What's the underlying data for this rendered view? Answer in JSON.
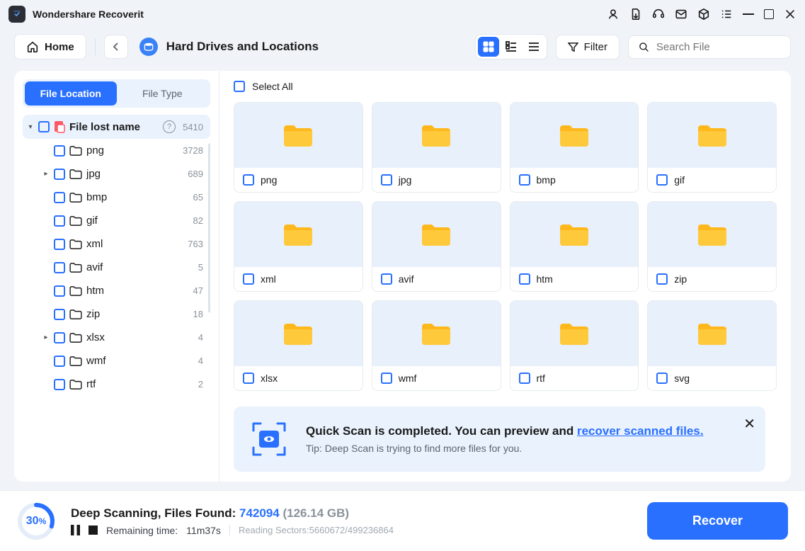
{
  "app": {
    "title": "Wondershare Recoverit"
  },
  "toolbar": {
    "home": "Home",
    "location_title": "Hard Drives and Locations",
    "filter": "Filter",
    "search_placeholder": "Search File"
  },
  "sidebar": {
    "tabs": {
      "location": "File Location",
      "type": "File Type"
    },
    "root": {
      "label": "File lost name",
      "count": "5410"
    },
    "items": [
      {
        "label": "png",
        "count": "3728",
        "expandable": false
      },
      {
        "label": "jpg",
        "count": "689",
        "expandable": true
      },
      {
        "label": "bmp",
        "count": "65",
        "expandable": false
      },
      {
        "label": "gif",
        "count": "82",
        "expandable": false
      },
      {
        "label": "xml",
        "count": "763",
        "expandable": false
      },
      {
        "label": "avif",
        "count": "5",
        "expandable": false
      },
      {
        "label": "htm",
        "count": "47",
        "expandable": false
      },
      {
        "label": "zip",
        "count": "18",
        "expandable": false
      },
      {
        "label": "xlsx",
        "count": "4",
        "expandable": true
      },
      {
        "label": "wmf",
        "count": "4",
        "expandable": false
      },
      {
        "label": "rtf",
        "count": "2",
        "expandable": false
      }
    ]
  },
  "content": {
    "select_all": "Select All",
    "folders": [
      "png",
      "jpg",
      "bmp",
      "gif",
      "xml",
      "avif",
      "htm",
      "zip",
      "xlsx",
      "wmf",
      "rtf",
      "svg"
    ]
  },
  "banner": {
    "title_prefix": "Quick Scan is completed. You can preview and ",
    "title_link": "recover scanned files.",
    "tip": "Tip: Deep Scan is trying to find more files for you."
  },
  "footer": {
    "percent": "30",
    "percent_sym": "%",
    "title_prefix": "Deep Scanning, Files Found: ",
    "count": "742094",
    "size": " (126.14 GB)",
    "remaining_label": "Remaining time:",
    "remaining_value": "11m37s",
    "sectors": "Reading Sectors:5660672/499236864",
    "recover": "Recover"
  }
}
